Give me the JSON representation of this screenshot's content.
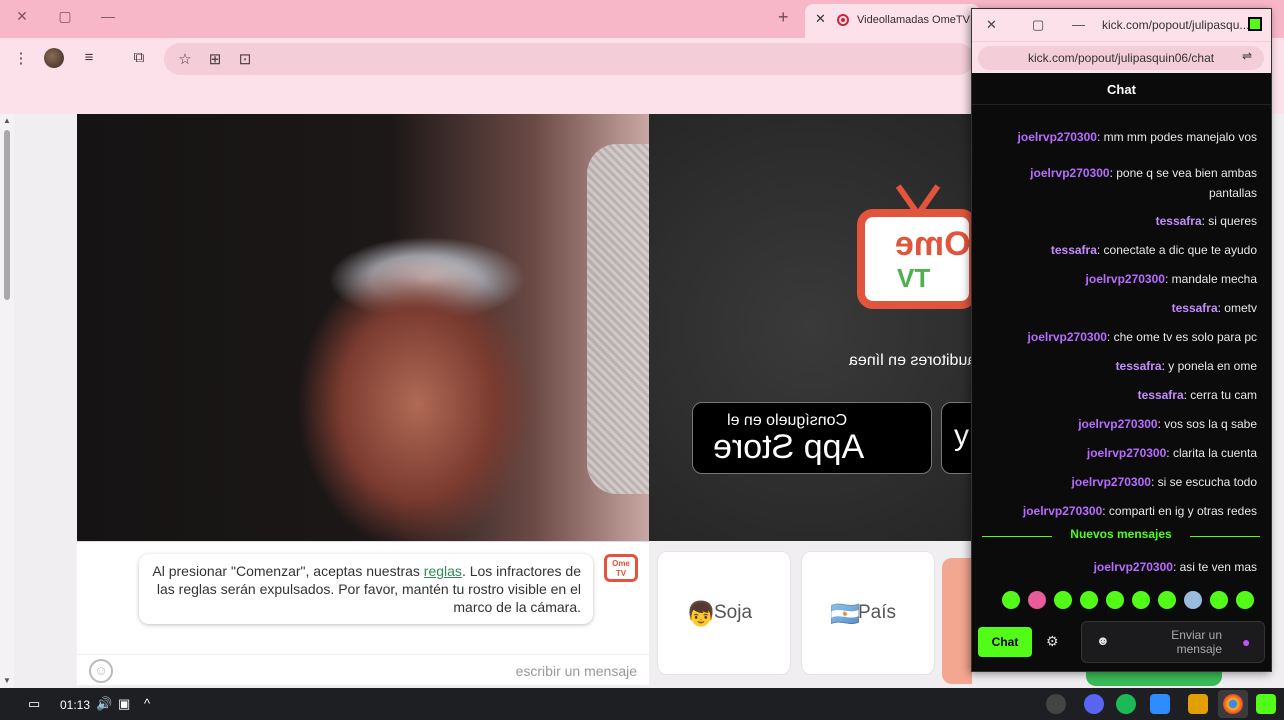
{
  "browser": {
    "tab_title": "Videollamadas OmeTV – A",
    "new_tab_icon": "plus-icon",
    "window_controls": [
      "close",
      "maximize",
      "minimize"
    ]
  },
  "page": {
    "audience_text": "espectadores/auditores en línea",
    "app_store_line1": "Consíguelo en el",
    "app_store_line2": "App Store",
    "google_play_fragment": "y",
    "ome_logo_top": "Ome",
    "ome_logo_bottom": "TV",
    "notice_before_link": "Al presionar \"Comenzar\", aceptas nuestras ",
    "notice_link": "reglas",
    "notice_after_link": ". Los infractores de las reglas serán expulsados. Por favor, mantén tu rostro visible en el marco de la cámara.",
    "message_placeholder": "escribir un mensaje",
    "gender_button": "Soja",
    "country_button": "País"
  },
  "popout": {
    "window_title": "kick.com/popout/julipasqu...",
    "url": "kick.com/popout/julipasquin06/chat",
    "chat_header": "Chat",
    "new_messages_label": "Nuevos mensajes",
    "input_placeholder": "Enviar un mensaje",
    "chat_button": "Chat",
    "messages": [
      {
        "user": "joelrvp270300",
        "text": ": mm mm podes manejalo vos"
      },
      {
        "user": "joelrvp270300",
        "text": ": pone q se vea bien ambas pantallas"
      },
      {
        "user": "tessafra",
        "text": ": si queres"
      },
      {
        "user": "tessafra",
        "text": ": conectate a dic que te ayudo"
      },
      {
        "user": "joelrvp270300",
        "text": ": mandale mecha"
      },
      {
        "user": "tessafra",
        "text": ": ometv"
      },
      {
        "user": "joelrvp270300",
        "text": ": che ome tv es solo para pc"
      },
      {
        "user": "tessafra",
        "text": ": y ponela en ome"
      },
      {
        "user": "tessafra",
        "text": ": cerra tu cam"
      },
      {
        "user": "joelrvp270300",
        "text": ": vos sos la q sabe"
      },
      {
        "user": "joelrvp270300",
        "text": ": clarita la cuenta"
      },
      {
        "user": "joelrvp270300",
        "text": ": si se escucha todo"
      },
      {
        "user": "joelrvp270300",
        "text": ": comparti en ig y otras redes"
      }
    ],
    "after_divider": {
      "user": "joelrvp270300",
      "text": ": asi te ven mas"
    },
    "user_colors": {
      "joelrvp270300": "#b86bff",
      "tessafra": "#c58cff"
    }
  },
  "taskbar": {
    "clock": "01:13"
  }
}
